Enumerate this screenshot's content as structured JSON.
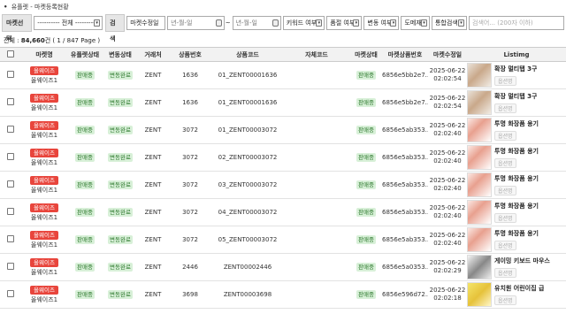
{
  "breadcrumb": {
    "bullet": "•",
    "text": "유플렛 - 마켓등록현황"
  },
  "toolbar": {
    "market_label": "마켓선택",
    "market_select": "---------- 전체 ----------",
    "search_label": "검색",
    "date_type": "마켓수정일",
    "date_from": "년-월-일",
    "date_sep": "~",
    "date_to": "년-월-일",
    "keyword_option": "키워드 여부",
    "image_option": "품절 여부",
    "change_option": "변동 여부",
    "domain_option": "도메재",
    "integrated_option": "통합검색",
    "search_placeholder": "검색어... (200자 이하)"
  },
  "count": {
    "label": "전체 : ",
    "total": "84,660",
    "unit": "건",
    "pages": "( 1 / 847 Page )"
  },
  "columns": [
    "",
    "마켓명",
    "유플렛상태",
    "변동상태",
    "거래처",
    "상품번호",
    "상품코드",
    "자체코드",
    "마켓상태",
    "마켓상품번호",
    "마켓수정일",
    "Listimg"
  ],
  "rows": [
    {
      "badge": "올웨이즈",
      "market": "올웨이즈1",
      "uplet_status": "판매중",
      "change": "변동완료",
      "vendor": "ZENT",
      "pno": "1636",
      "code": "01_ZENT00001636",
      "own": "",
      "mstatus": "판매중",
      "mno": "6856e5bb2e7...",
      "date": "2025-06-22",
      "time": "02:02:54",
      "title": "확장 멀티탭 3구",
      "sub": "옵션명",
      "thumb": "t1"
    },
    {
      "badge": "올웨이즈",
      "market": "올웨이즈1",
      "uplet_status": "판매중",
      "change": "변동완료",
      "vendor": "ZENT",
      "pno": "1636",
      "code": "01_ZENT00001636",
      "own": "",
      "mstatus": "판매중",
      "mno": "6856e5bb2e7...",
      "date": "2025-06-22",
      "time": "02:02:54",
      "title": "확장 멀티탭 3구",
      "sub": "옵션명",
      "thumb": "t1"
    },
    {
      "badge": "올웨이즈",
      "market": "올웨이즈1",
      "uplet_status": "판매중",
      "change": "변동완료",
      "vendor": "ZENT",
      "pno": "3072",
      "code": "01_ZENT00003072",
      "own": "",
      "mstatus": "판매중",
      "mno": "6856e5ab353...",
      "date": "2025-06-22",
      "time": "02:02:40",
      "title": "투명 화장품 용기",
      "sub": "옵션명",
      "thumb": "t2"
    },
    {
      "badge": "올웨이즈",
      "market": "올웨이즈1",
      "uplet_status": "판매중",
      "change": "변동완료",
      "vendor": "ZENT",
      "pno": "3072",
      "code": "02_ZENT00003072",
      "own": "",
      "mstatus": "판매중",
      "mno": "6856e5ab353...",
      "date": "2025-06-22",
      "time": "02:02:40",
      "title": "투명 화장품 용기",
      "sub": "옵션명",
      "thumb": "t2"
    },
    {
      "badge": "올웨이즈",
      "market": "올웨이즈1",
      "uplet_status": "판매중",
      "change": "변동완료",
      "vendor": "ZENT",
      "pno": "3072",
      "code": "03_ZENT00003072",
      "own": "",
      "mstatus": "판매중",
      "mno": "6856e5ab353...",
      "date": "2025-06-22",
      "time": "02:02:40",
      "title": "투명 화장품 용기",
      "sub": "옵션명",
      "thumb": "t2"
    },
    {
      "badge": "올웨이즈",
      "market": "올웨이즈1",
      "uplet_status": "판매중",
      "change": "변동완료",
      "vendor": "ZENT",
      "pno": "3072",
      "code": "04_ZENT00003072",
      "own": "",
      "mstatus": "판매중",
      "mno": "6856e5ab353...",
      "date": "2025-06-22",
      "time": "02:02:40",
      "title": "투명 화장품 용기",
      "sub": "옵션명",
      "thumb": "t2"
    },
    {
      "badge": "올웨이즈",
      "market": "올웨이즈1",
      "uplet_status": "판매중",
      "change": "변동완료",
      "vendor": "ZENT",
      "pno": "3072",
      "code": "05_ZENT00003072",
      "own": "",
      "mstatus": "판매중",
      "mno": "6856e5ab353...",
      "date": "2025-06-22",
      "time": "02:02:40",
      "title": "투명 화장품 용기",
      "sub": "옵션명",
      "thumb": "t2"
    },
    {
      "badge": "올웨이즈",
      "market": "올웨이즈1",
      "uplet_status": "판매중",
      "change": "변동완료",
      "vendor": "ZENT",
      "pno": "2446",
      "code": "ZENT00002446",
      "own": "",
      "mstatus": "판매중",
      "mno": "6856e5a0353...",
      "date": "2025-06-22",
      "time": "02:02:29",
      "title": "게이밍 키보드 마우스",
      "sub": "옵션명",
      "thumb": "t3"
    },
    {
      "badge": "올웨이즈",
      "market": "올웨이즈1",
      "uplet_status": "판매중",
      "change": "변동완료",
      "vendor": "ZENT",
      "pno": "3698",
      "code": "ZENT00003698",
      "own": "",
      "mstatus": "판매중",
      "mno": "6856e596d72...",
      "date": "2025-06-22",
      "time": "02:02:18",
      "title": "유치원 어린이집 급",
      "sub": "옵션명",
      "thumb": "t4"
    }
  ]
}
